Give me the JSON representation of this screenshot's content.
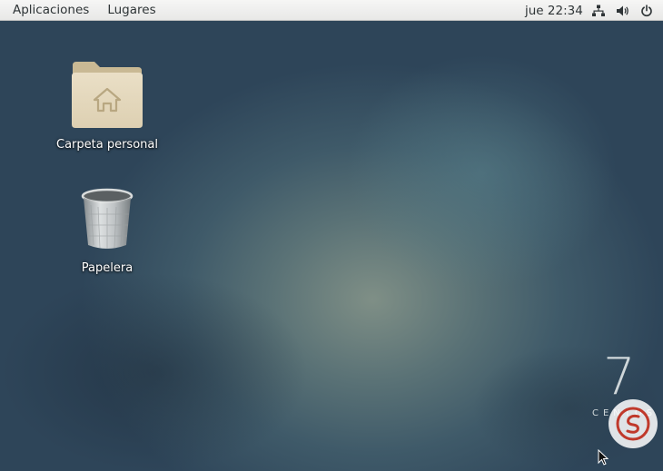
{
  "panel": {
    "applications_label": "Aplicaciones",
    "places_label": "Lugares",
    "clock": "jue 22:34"
  },
  "tray": {
    "icons": [
      "network-icon",
      "volume-icon",
      "power-icon"
    ]
  },
  "desktop": {
    "icons": [
      {
        "label": "Carpeta personal",
        "icon": "home-folder-icon"
      },
      {
        "label": "Papelera",
        "icon": "trash-icon"
      }
    ]
  },
  "branding": {
    "version": "7",
    "name": "CENTOS"
  },
  "colors": {
    "panel_bg": "#efefee",
    "panel_text": "#2e3436",
    "folder": "#e2d6bc",
    "folder_dark": "#c9b994",
    "wallpaper": "#3f5a69"
  }
}
